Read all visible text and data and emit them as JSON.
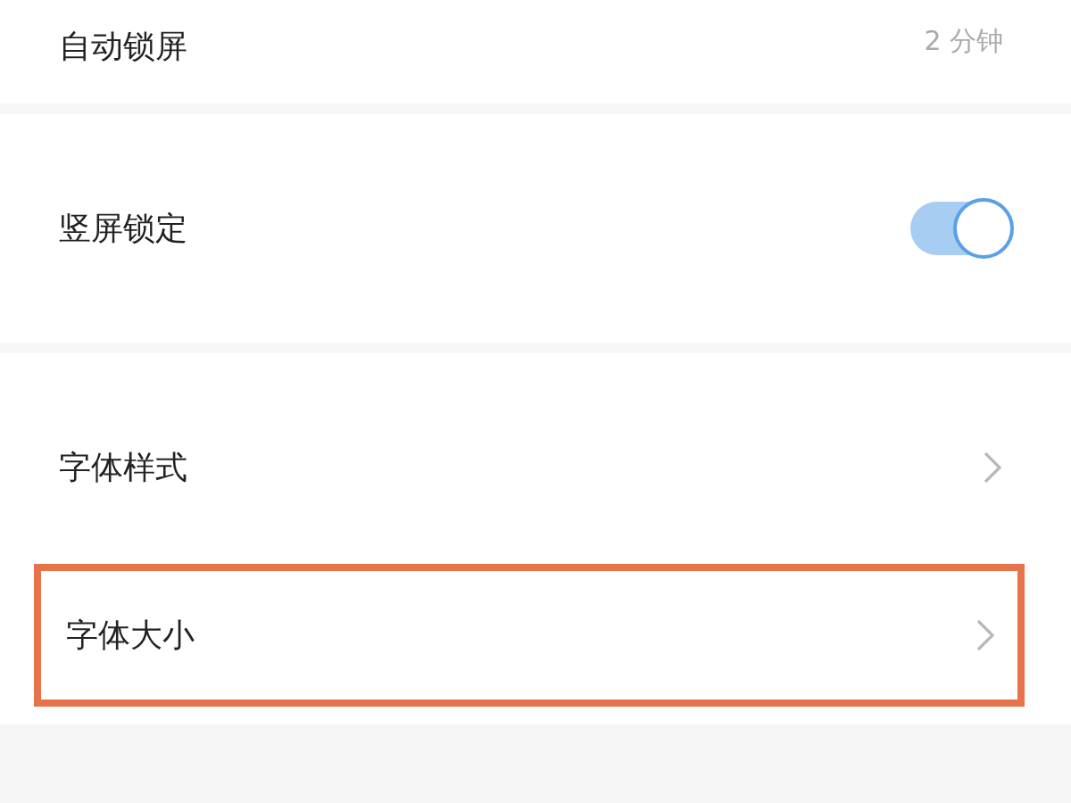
{
  "settings": [
    {
      "kind": "value",
      "label": "自动锁屏",
      "value": "2 分钟",
      "highlighted": false
    },
    {
      "kind": "toggle",
      "label": "竖屏锁定",
      "on": true,
      "highlighted": false
    },
    {
      "kind": "link",
      "label": "字体样式",
      "highlighted": false
    },
    {
      "kind": "link",
      "label": "字体大小",
      "highlighted": true
    }
  ]
}
